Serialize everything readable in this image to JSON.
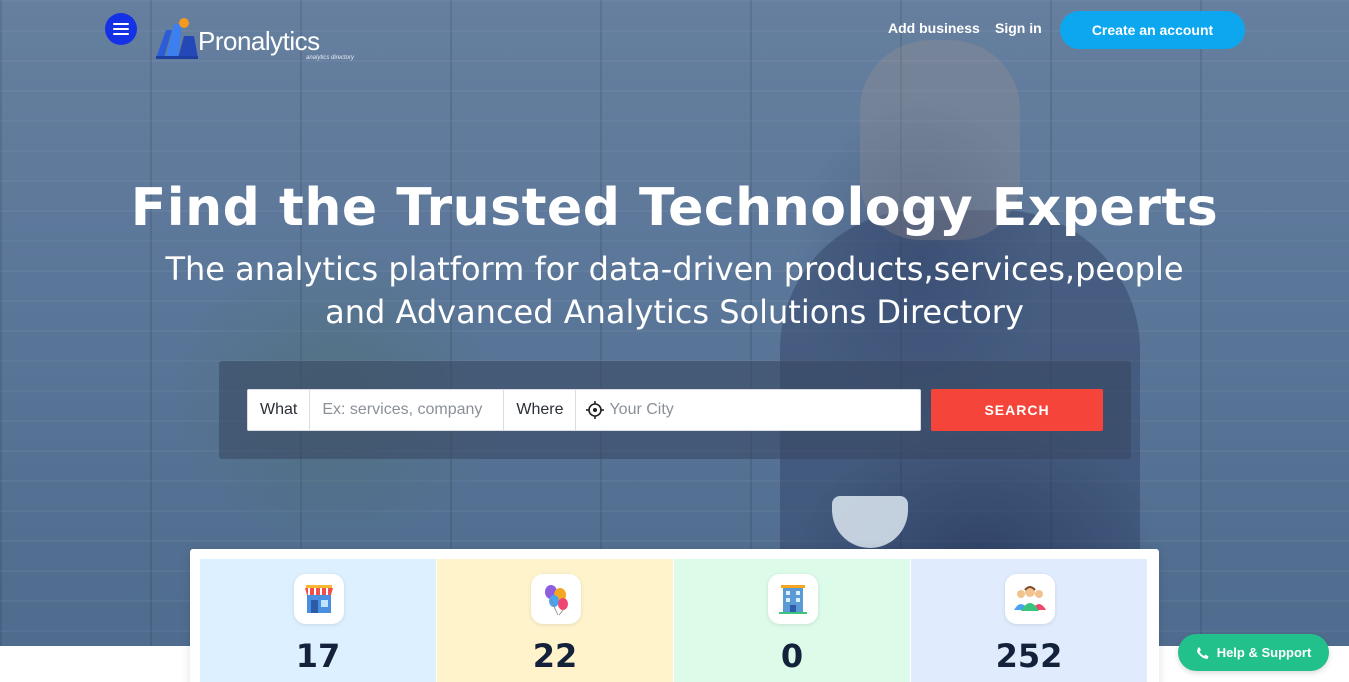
{
  "brand": {
    "name": "Pronalytics",
    "tagline": "analytics directory"
  },
  "nav": {
    "add_business": "Add business",
    "sign_in": "Sign in",
    "create_account": "Create an account"
  },
  "hero": {
    "title": "Find the Trusted Technology Experts",
    "subtitle_line1": "The analytics platform for data-driven products,services,people",
    "subtitle_line2": "and Advanced Analytics Solutions Directory"
  },
  "search": {
    "what_label": "What",
    "what_placeholder": "Ex: services, company",
    "where_label": "Where",
    "where_placeholder": "Your City",
    "button": "SEARCH"
  },
  "stats": [
    {
      "icon": "store-icon",
      "value": "17",
      "bg": "#ddf0ff"
    },
    {
      "icon": "balloons-icon",
      "value": "22",
      "bg": "#fff3cc"
    },
    {
      "icon": "building-icon",
      "value": "0",
      "bg": "#dcfbe9"
    },
    {
      "icon": "users-group-icon",
      "value": "252",
      "bg": "#e0ecfe"
    }
  ],
  "help": {
    "label": "Help & Support"
  },
  "colors": {
    "menu_button": "#1531e6",
    "create_button": "#0da7ef",
    "search_button": "#f5443a",
    "help_button": "#22c08a"
  }
}
